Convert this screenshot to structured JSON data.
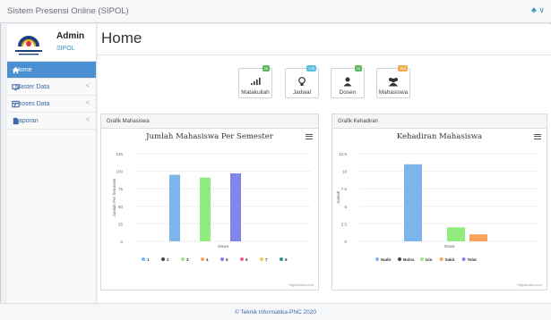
{
  "app": {
    "title": "Sistem Presensi Online (SIPOL)",
    "user_menu": "♣ ∨"
  },
  "profile": {
    "name": "Admin",
    "role": "SIPOL",
    "logo_text": "POLITEKNIK NEGERI CILACAP"
  },
  "sidebar": {
    "items": [
      {
        "label": "Home",
        "icon": "home-icon",
        "active": true,
        "has_chevron": false
      },
      {
        "label": "Master Data",
        "icon": "monitor-icon",
        "active": false,
        "has_chevron": true
      },
      {
        "label": "Proses Data",
        "icon": "table-icon",
        "active": false,
        "has_chevron": true
      },
      {
        "label": "Laporan",
        "icon": "file-icon",
        "active": false,
        "has_chevron": true
      }
    ],
    "chevron": "<"
  },
  "main": {
    "title": "Home"
  },
  "tiles": [
    {
      "label": "Matakuliah",
      "badge": "26",
      "badge_color": "#5cb85c",
      "icon": "signal-bars-icon"
    },
    {
      "label": "Jadwal",
      "badge": "+28",
      "badge_color": "#5bc0de",
      "icon": "lightbulb-icon"
    },
    {
      "label": "Dosen",
      "badge": "23",
      "badge_color": "#5cb85c",
      "icon": "user-icon"
    },
    {
      "label": "Mahasiswa",
      "badge": "253",
      "badge_color": "#f0ad4e",
      "icon": "users-icon"
    }
  ],
  "panels": {
    "left": {
      "header": "Grafik Mahasiswa"
    },
    "right": {
      "header": "Grafik Kehadiran"
    }
  },
  "credits": "Highcharts.com",
  "footer": "© Teknik Informatika-PNC 2020",
  "chart_data": [
    {
      "type": "bar",
      "title": "Jumlah Mahasiswa Per Semester",
      "xlabel": "Siswa",
      "ylabel": "Jumlah Per Semester",
      "ylim": [
        0,
        125
      ],
      "yticks": [
        0,
        25,
        50,
        75,
        100,
        125
      ],
      "categories": [
        "Siswa"
      ],
      "series": [
        {
          "name": "1",
          "values": [
            0
          ],
          "color": "#7cb5ec"
        },
        {
          "name": "2",
          "values": [
            0
          ],
          "color": "#434348"
        },
        {
          "name": "3",
          "values": [
            0
          ],
          "color": "#90ed7d"
        },
        {
          "name": "4",
          "values": [
            0
          ],
          "color": "#f7a35c"
        },
        {
          "name": "5",
          "values": [
            0
          ],
          "color": "#8085e9"
        },
        {
          "name": "6",
          "values": [
            0
          ],
          "color": "#f15c80"
        },
        {
          "name": "7",
          "values": [
            0
          ],
          "color": "#e4d354"
        },
        {
          "name": "8",
          "values": [
            0
          ],
          "color": "#2b908f"
        }
      ],
      "bars": [
        {
          "series": "1",
          "value": 95,
          "color": "#7cb5ec"
        },
        {
          "series": "3",
          "value": 91,
          "color": "#90ed7d"
        },
        {
          "series": "5",
          "value": 97,
          "color": "#8085e9"
        }
      ],
      "grid": true,
      "legend": "bottom"
    },
    {
      "type": "bar",
      "title": "Kehadiran Mahasiswa",
      "xlabel": "Siswa",
      "ylabel": "Jumlah",
      "ylim": [
        0,
        12.5
      ],
      "yticks": [
        0,
        2.5,
        5,
        7.5,
        10,
        12.5
      ],
      "categories": [
        "Siswa"
      ],
      "series": [
        {
          "name": "Hadir",
          "values": [
            11
          ],
          "color": "#7cb5ec"
        },
        {
          "name": "Bolos",
          "values": [
            0
          ],
          "color": "#434348"
        },
        {
          "name": "Izin",
          "values": [
            2
          ],
          "color": "#90ed7d"
        },
        {
          "name": "Sakit",
          "values": [
            1
          ],
          "color": "#f7a35c"
        },
        {
          "name": "Telat",
          "values": [
            0
          ],
          "color": "#8085e9"
        }
      ],
      "grid": true,
      "legend": "bottom"
    }
  ]
}
